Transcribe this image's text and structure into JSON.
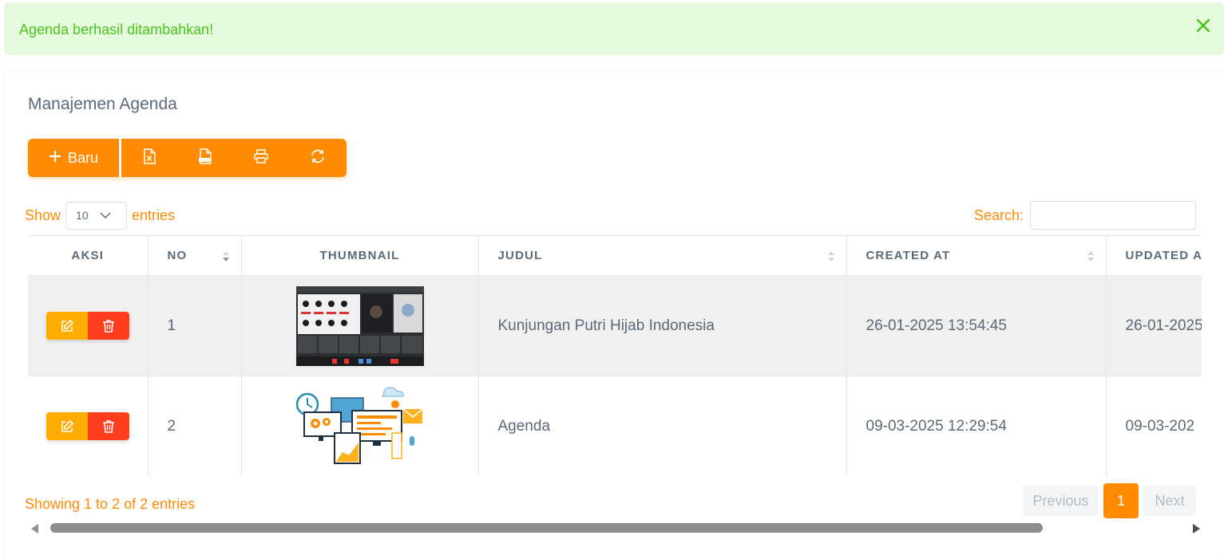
{
  "alert": {
    "message": "Agenda berhasil ditambahkan!",
    "close_icon": "close-icon",
    "color": "#4bc41d",
    "background": "#e5f9dd"
  },
  "card": {
    "title": "Manajemen Agenda"
  },
  "toolbar": {
    "new_label": "Baru",
    "new_icon": "plus-icon",
    "icons": [
      "excel-file-icon",
      "csv-file-icon",
      "print-icon",
      "refresh-icon"
    ],
    "accent": "#ff8b03"
  },
  "length": {
    "show_label": "Show",
    "selected": "10",
    "entries_label": "entries"
  },
  "search": {
    "label": "Search:",
    "value": ""
  },
  "table": {
    "headers": [
      "AKSI",
      "NO",
      "THUMBNAIL",
      "JUDUL",
      "CREATED AT",
      "UPDATED AT"
    ],
    "rows": [
      {
        "no": "1",
        "thumbnail": "video-conference-photo",
        "judul": "Kunjungan Putri Hijab Indonesia",
        "created_at": "26-01-2025 13:54:45",
        "updated_at": "26-01-2025"
      },
      {
        "no": "2",
        "thumbnail": "office-illustration",
        "judul": "Agenda",
        "created_at": "09-03-2025 12:29:54",
        "updated_at": "09-03-202"
      }
    ]
  },
  "footer": {
    "info": "Showing 1 to 2 of 2 entries"
  },
  "pagination": {
    "previous": "Previous",
    "current": "1",
    "next": "Next"
  }
}
